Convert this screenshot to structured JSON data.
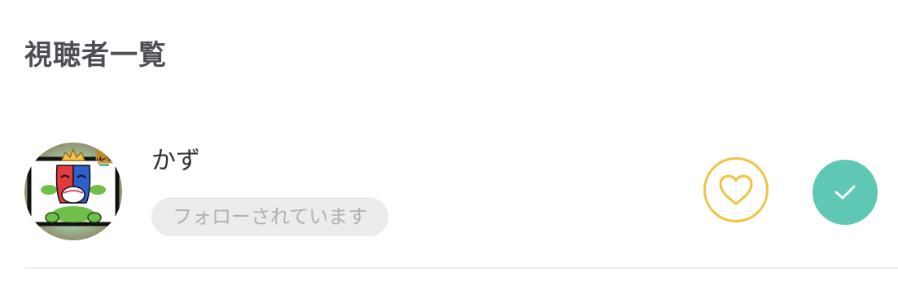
{
  "page": {
    "title": "視聴者一覧"
  },
  "viewers": [
    {
      "name": "かず",
      "status": "フォローされています",
      "avatar_badge": "極",
      "avatar_icon": "clash-royale-goblin-avatar",
      "actions": {
        "like_icon": "heart-icon",
        "confirm_icon": "check-icon"
      }
    }
  ],
  "colors": {
    "title": "#4c4e55",
    "heart_accent": "#f2c33c",
    "check_accent": "#5fc8b4",
    "badge_bg": "#ececec",
    "badge_text": "#b1b1b1"
  }
}
